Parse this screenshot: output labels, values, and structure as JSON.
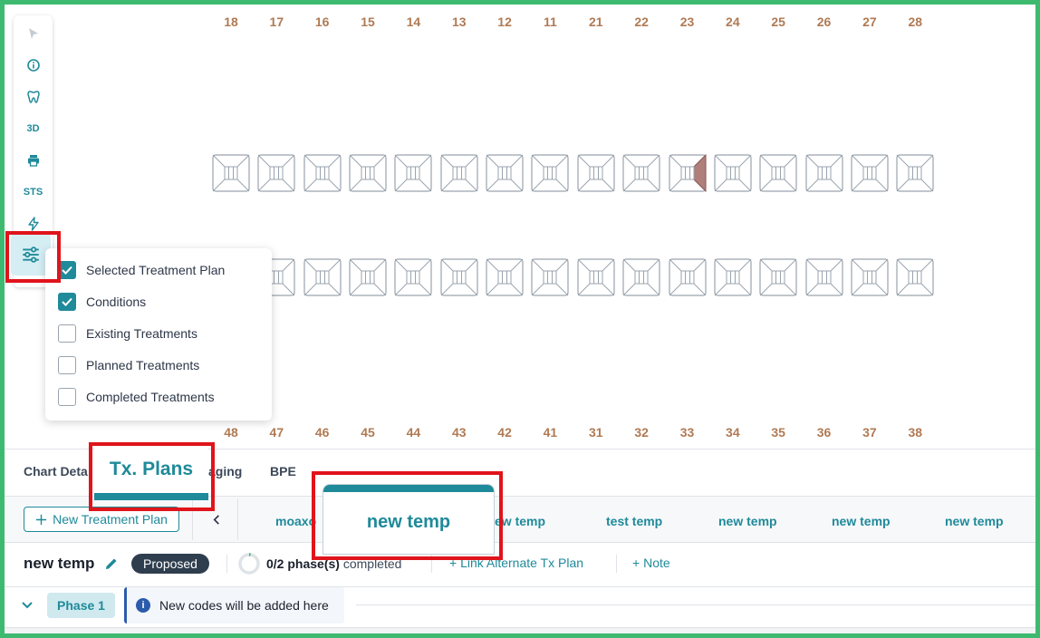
{
  "upper_teeth": [
    "18",
    "17",
    "16",
    "15",
    "14",
    "13",
    "12",
    "11",
    "21",
    "22",
    "23",
    "24",
    "25",
    "26",
    "27",
    "28"
  ],
  "lower_teeth": [
    "48",
    "47",
    "46",
    "45",
    "44",
    "43",
    "42",
    "41",
    "31",
    "32",
    "33",
    "34",
    "35",
    "36",
    "37",
    "38"
  ],
  "toolbar": {
    "items": [
      {
        "icon": "pointer-icon"
      },
      {
        "icon": "info-icon"
      },
      {
        "icon": "tooth-icon"
      },
      {
        "label": "3D"
      },
      {
        "icon": "printer-icon"
      },
      {
        "label": "STS"
      },
      {
        "icon": "lightning-icon"
      },
      {
        "icon": "sliders-icon"
      }
    ]
  },
  "filter_menu": {
    "items": [
      {
        "label": "Selected Treatment Plan",
        "checked": true
      },
      {
        "label": "Conditions",
        "checked": true
      },
      {
        "label": "Existing Treatments",
        "checked": false
      },
      {
        "label": "Planned Treatments",
        "checked": false
      },
      {
        "label": "Completed Treatments",
        "checked": false
      }
    ]
  },
  "tabs": {
    "chart_details": "Chart Deta",
    "tx_plans": "Tx. Plans",
    "imaging": "aging",
    "bpe": "BPE"
  },
  "plans": {
    "new_button": "New Treatment Plan",
    "items": [
      "moaxo",
      "new temp",
      "new temp",
      "test temp",
      "new temp",
      "new temp",
      "new temp"
    ],
    "active": "new temp",
    "partial_label": "ew temp"
  },
  "plan_header": {
    "title": "new temp",
    "status": "Proposed",
    "phases_count": "0/2 phase(s)",
    "phases_suffix": "completed",
    "link_alt": "Link Alternate Tx Plan",
    "note": "Note"
  },
  "phase": {
    "label": "Phase 1",
    "info": "New codes will be added here"
  },
  "colors": {
    "accent": "#1f8a9a",
    "tooth_number": "#b07a54",
    "condition_fill": "#b07f7a",
    "highlight": "#e0141b",
    "frame": "#3dba6f"
  }
}
